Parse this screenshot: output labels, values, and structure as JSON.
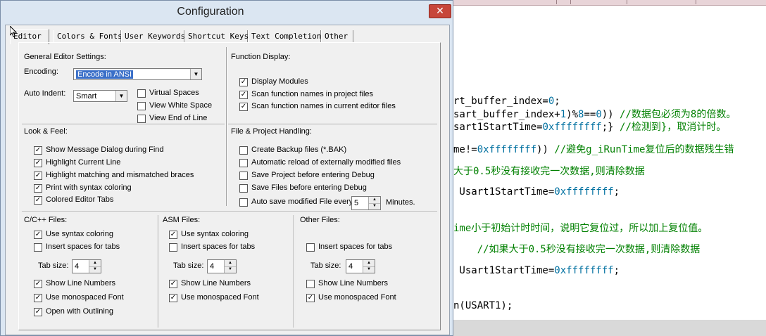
{
  "dialog": {
    "title": "Configuration",
    "close_glyph": "✕"
  },
  "tabs": [
    {
      "label": "Editor",
      "active": true
    },
    {
      "label": "Colors & Fonts"
    },
    {
      "label": "User Keywords"
    },
    {
      "label": "Shortcut Keys"
    },
    {
      "label": "Text Completion"
    },
    {
      "label": "Other"
    }
  ],
  "general": {
    "label": "General Editor Settings:",
    "encoding_label": "Encoding:",
    "encoding_value": "Encode in ANSI",
    "auto_indent_label": "Auto Indent:",
    "auto_indent_value": "Smart",
    "virtual_spaces": {
      "label": "Virtual Spaces",
      "checked": false
    },
    "view_white_space": {
      "label": "View White Space",
      "checked": false
    },
    "view_end_of_line": {
      "label": "View End of Line",
      "checked": false
    }
  },
  "function_display": {
    "label": "Function Display:",
    "items": [
      {
        "label": "Display Modules",
        "checked": true
      },
      {
        "label": "Scan function names in project files",
        "checked": true
      },
      {
        "label": "Scan function names in current editor files",
        "checked": true
      }
    ]
  },
  "look_feel": {
    "label": "Look & Feel:",
    "items": [
      {
        "label": "Show Message Dialog during Find",
        "checked": true
      },
      {
        "label": "Highlight Current Line",
        "checked": true
      },
      {
        "label": "Highlight matching and mismatched braces",
        "checked": true
      },
      {
        "label": "Print with syntax coloring",
        "checked": true
      },
      {
        "label": "Colored Editor Tabs",
        "checked": true
      }
    ]
  },
  "file_project": {
    "label": "File & Project Handling:",
    "items": [
      {
        "label": "Create Backup files (*.BAK)",
        "checked": false
      },
      {
        "label": "Automatic reload of externally modified files",
        "checked": false
      },
      {
        "label": "Save Project before entering Debug",
        "checked": false
      },
      {
        "label": "Save Files before entering Debug",
        "checked": false
      }
    ],
    "auto_save": {
      "label": "Auto save modified File every",
      "checked": false,
      "value": "5",
      "unit": "Minutes."
    }
  },
  "cpp_files": {
    "label": "C/C++ Files:",
    "use_syntax_coloring": {
      "label": "Use syntax coloring",
      "checked": true
    },
    "insert_spaces": {
      "label": "Insert spaces for tabs",
      "checked": false
    },
    "tab_size_label": "Tab size:",
    "tab_size": "4",
    "show_line_numbers": {
      "label": "Show Line Numbers",
      "checked": true
    },
    "monospaced": {
      "label": "Use monospaced Font",
      "checked": true
    },
    "outlining": {
      "label": "Open with Outlining",
      "checked": true
    }
  },
  "asm_files": {
    "label": "ASM Files:",
    "use_syntax_coloring": {
      "label": "Use syntax coloring",
      "checked": true
    },
    "insert_spaces": {
      "label": "Insert spaces for tabs",
      "checked": false
    },
    "tab_size_label": "Tab size:",
    "tab_size": "4",
    "show_line_numbers": {
      "label": "Show Line Numbers",
      "checked": true
    },
    "monospaced": {
      "label": "Use monospaced Font",
      "checked": true
    }
  },
  "other_files": {
    "label": "Other Files:",
    "insert_spaces": {
      "label": "Insert spaces for tabs",
      "checked": false
    },
    "tab_size_label": "Tab size:",
    "tab_size": "4",
    "show_line_numbers": {
      "label": "Show Line Numbers",
      "checked": false
    },
    "monospaced": {
      "label": "Use monospaced Font",
      "checked": true
    }
  },
  "editor_code": {
    "lines": [
      [
        {
          "t": "rt_buffer_index=",
          "c": "text"
        },
        {
          "t": "0",
          "c": "num"
        },
        {
          "t": ";",
          "c": "text"
        }
      ],
      [
        {
          "t": "sart_buffer_index+",
          "c": "text"
        },
        {
          "t": "1",
          "c": "num"
        },
        {
          "t": ")%",
          "c": "text"
        },
        {
          "t": "8",
          "c": "num"
        },
        {
          "t": "==",
          "c": "text"
        },
        {
          "t": "0",
          "c": "num"
        },
        {
          "t": ")) ",
          "c": "text"
        },
        {
          "t": "//数据包必须为8的倍数。",
          "c": "cmt"
        }
      ],
      [
        {
          "t": "sart1StartTime=",
          "c": "text"
        },
        {
          "t": "0xffffffff",
          "c": "num"
        },
        {
          "t": ";} ",
          "c": "text"
        },
        {
          "t": "//检测到}，取消计时。",
          "c": "cmt"
        }
      ],
      [
        {
          "t": "me!=",
          "c": "text"
        },
        {
          "t": "0xffffffff",
          "c": "num"
        },
        {
          "t": ")) ",
          "c": "text"
        },
        {
          "t": "//避免g_iRunTime复位后的数据残生错",
          "c": "cmt"
        }
      ],
      [
        {
          "t": "大于0.5秒没有接收完一次数据,则清除数据",
          "c": "cmt"
        }
      ],
      [
        {
          "t": " Usart1StartTime=",
          "c": "text"
        },
        {
          "t": "0xffffffff",
          "c": "num"
        },
        {
          "t": ";",
          "c": "text"
        }
      ],
      [
        {
          "t": "ime小于初始计时时间，说明它复位过，所以加上复位值。",
          "c": "cmt"
        }
      ],
      [
        {
          "t": "    //如果大于0.5秒没有接收完一次数据,则清除数据",
          "c": "cmt"
        }
      ],
      [
        {
          "t": " Usart1StartTime=",
          "c": "text"
        },
        {
          "t": "0xffffffff",
          "c": "num"
        },
        {
          "t": ";",
          "c": "text"
        }
      ],
      [
        {
          "t": "n(USART1);",
          "c": "text"
        }
      ]
    ]
  },
  "colors": {
    "tab_strip": "#e8d4d8",
    "comment": "#008000",
    "number": "#0070a0"
  }
}
